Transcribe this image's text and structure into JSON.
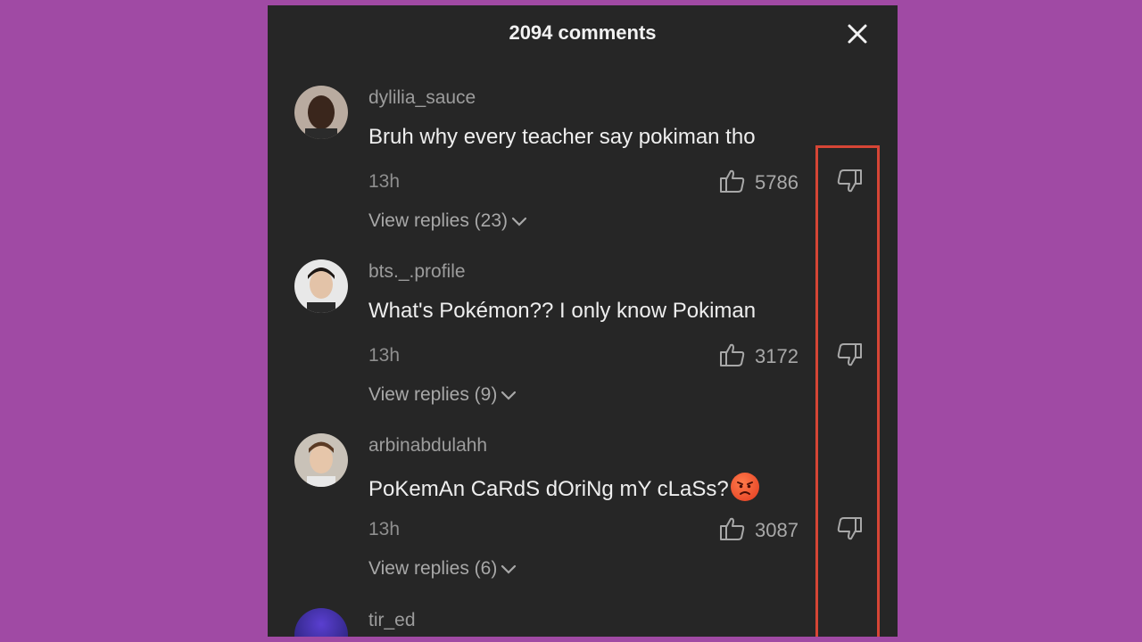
{
  "header": {
    "title": "2094 comments"
  },
  "comments": [
    {
      "username": "dylilia_sauce",
      "text": "Bruh why every teacher say pokiman tho",
      "time": "13h",
      "likes": "5786",
      "replies": "View replies (23)"
    },
    {
      "username": "bts._.profile",
      "text": "What's Pokémon?? I only know Pokiman",
      "time": "13h",
      "likes": "3172",
      "replies": "View replies (9)"
    },
    {
      "username": "arbinabdulahh",
      "text": "PoKemAn CaRdS dOriNg mY cLaSs?",
      "emoji": "angry-face-emoji",
      "time": "13h",
      "likes": "3087",
      "replies": "View replies (6)"
    }
  ],
  "partial_comment": {
    "username": "tir_ed"
  },
  "colors": {
    "background": "#a04aa4",
    "panel": "#262626",
    "highlight": "#d64535"
  }
}
